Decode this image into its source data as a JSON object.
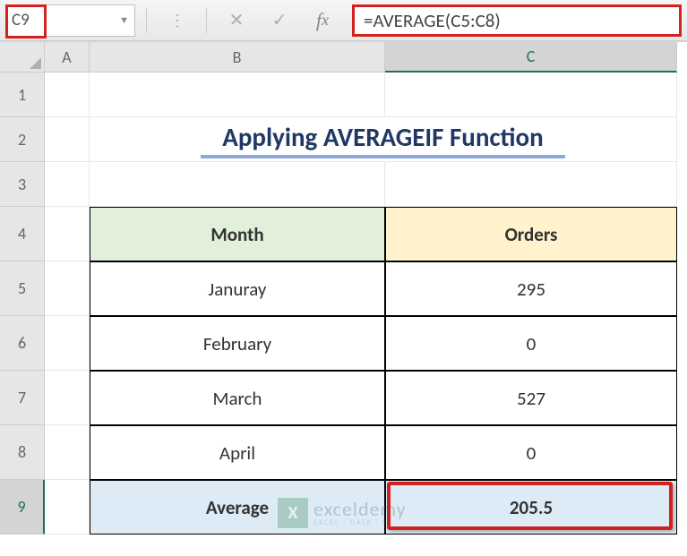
{
  "formula_bar": {
    "cell_ref": "C9",
    "formula": "=AVERAGE(C5:C8)"
  },
  "columns": [
    "A",
    "B",
    "C"
  ],
  "rows": [
    "1",
    "2",
    "3",
    "4",
    "5",
    "6",
    "7",
    "8",
    "9"
  ],
  "title": "Applying AVERAGEIF Function",
  "table": {
    "headers": {
      "month": "Month",
      "orders": "Orders"
    },
    "rows": [
      {
        "month": "Januray",
        "orders": "295"
      },
      {
        "month": "February",
        "orders": "0"
      },
      {
        "month": "March",
        "orders": "527"
      },
      {
        "month": "April",
        "orders": "0"
      }
    ],
    "average_label": "Average",
    "average_value": "205.5"
  },
  "watermark": {
    "brand": "exceldemy",
    "tag": "EXCEL · DATA · B"
  },
  "chart_data": {
    "type": "table",
    "title": "Applying AVERAGEIF Function",
    "columns": [
      "Month",
      "Orders"
    ],
    "rows": [
      [
        "Januray",
        295
      ],
      [
        "February",
        0
      ],
      [
        "March",
        527
      ],
      [
        "April",
        0
      ]
    ],
    "summary": {
      "label": "Average",
      "value": 205.5,
      "formula": "=AVERAGE(C5:C8)"
    }
  }
}
